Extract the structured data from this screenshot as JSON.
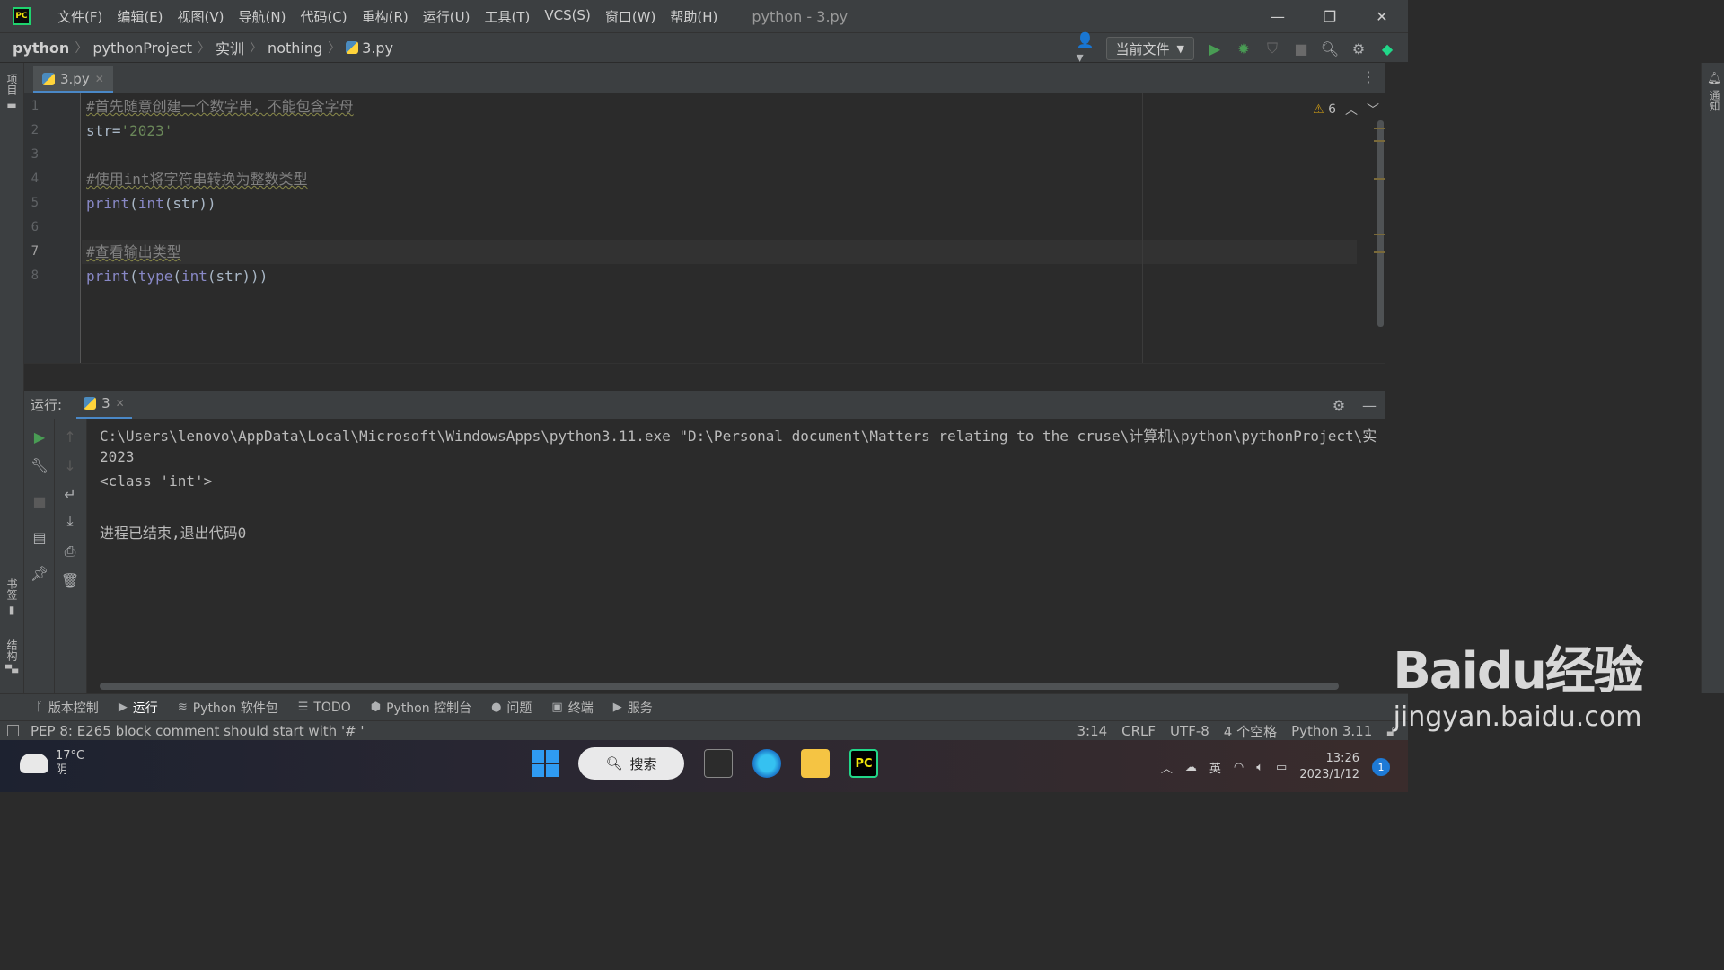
{
  "titlebar": {
    "logo": "PC",
    "menu": [
      "文件(F)",
      "编辑(E)",
      "视图(V)",
      "导航(N)",
      "代码(C)",
      "重构(R)",
      "运行(U)",
      "工具(T)",
      "VCS(S)",
      "窗口(W)",
      "帮助(H)"
    ],
    "title": "python - 3.py"
  },
  "breadcrumb": [
    "python",
    "pythonProject",
    "实训",
    "nothing",
    "3.py"
  ],
  "toolbar": {
    "run_config": "当前文件"
  },
  "left_stripe": {
    "project": "项目",
    "bookmarks": "书签",
    "structure": "结构"
  },
  "right_stripe": {
    "notifications": "通知"
  },
  "editor": {
    "tab": "3.py",
    "warnings": "6",
    "lines": [
      {
        "n": "1",
        "parts": [
          {
            "t": "#首先随意创建一个数字串，不能包含字母",
            "c": "cmt"
          }
        ]
      },
      {
        "n": "2",
        "parts": [
          {
            "t": "str=",
            "c": "pl"
          },
          {
            "t": "'2023'",
            "c": "str"
          }
        ]
      },
      {
        "n": "3",
        "parts": []
      },
      {
        "n": "4",
        "parts": [
          {
            "t": "#使用int将字符串转换为整数类型",
            "c": "cmt"
          }
        ]
      },
      {
        "n": "5",
        "parts": [
          {
            "t": "print",
            "c": "kw-b"
          },
          {
            "t": "(",
            "c": "pl"
          },
          {
            "t": "int",
            "c": "kw-b"
          },
          {
            "t": "(str))",
            "c": "pl"
          }
        ]
      },
      {
        "n": "6",
        "parts": []
      },
      {
        "n": "7",
        "parts": [
          {
            "t": "#查看输出类型",
            "c": "cmt"
          }
        ]
      },
      {
        "n": "8",
        "parts": [
          {
            "t": "print",
            "c": "kw-b"
          },
          {
            "t": "(",
            "c": "pl"
          },
          {
            "t": "type",
            "c": "kw-b"
          },
          {
            "t": "(",
            "c": "pl"
          },
          {
            "t": "int",
            "c": "kw-b"
          },
          {
            "t": "(str)))",
            "c": "pl"
          }
        ]
      }
    ]
  },
  "run": {
    "label": "运行:",
    "tab": "3",
    "console": [
      "C:\\Users\\lenovo\\AppData\\Local\\Microsoft\\WindowsApps\\python3.11.exe \"D:\\Personal document\\Matters relating to the cruse\\计算机\\python\\pythonProject\\实",
      "2023",
      "<class 'int'>",
      "",
      "进程已结束,退出代码0"
    ]
  },
  "tool_tabs": [
    {
      "icon": "git-branch-icon",
      "glyph": "ᚴ",
      "label": "版本控制"
    },
    {
      "icon": "run-icon",
      "glyph": "▶",
      "label": "运行"
    },
    {
      "icon": "layers-icon",
      "glyph": "≋",
      "label": "Python 软件包"
    },
    {
      "icon": "list-icon",
      "glyph": "☰",
      "label": "TODO"
    },
    {
      "icon": "python-icon",
      "glyph": "⬢",
      "label": "Python 控制台"
    },
    {
      "icon": "info-icon",
      "glyph": "●",
      "label": "问题"
    },
    {
      "icon": "terminal-icon",
      "glyph": "▣",
      "label": "终端"
    },
    {
      "icon": "services-icon",
      "glyph": "▶",
      "label": "服务"
    }
  ],
  "status": {
    "message": "PEP 8: E265 block comment should start with '# '",
    "position": "3:14",
    "line_sep": "CRLF",
    "encoding": "UTF-8",
    "indent": "4 个空格",
    "interpreter": "Python 3.11"
  },
  "taskbar": {
    "temp": "17°C",
    "weather": "阴",
    "search": "搜索",
    "ime": "英",
    "time": "13:26",
    "date": "2023/1/12",
    "notify_count": "1"
  },
  "watermark": {
    "logo": "Baidu经验",
    "url": "jingyan.baidu.com"
  },
  "colors": {
    "accent": "#4a88c7",
    "run_green": "#499c54",
    "warning": "#be9117"
  }
}
